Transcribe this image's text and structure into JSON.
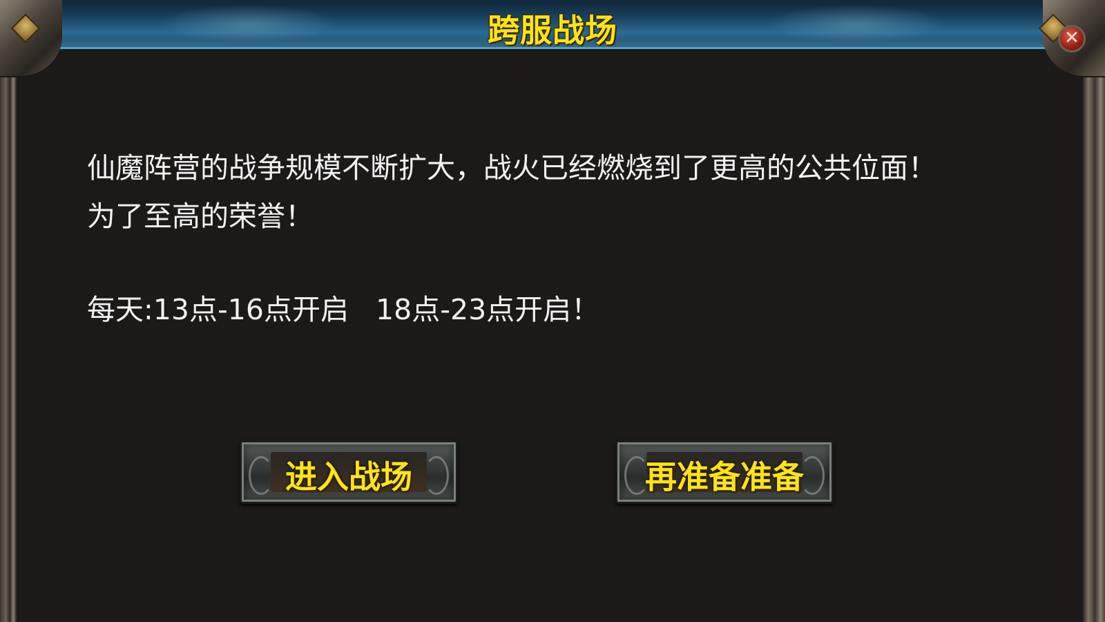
{
  "dialog": {
    "title": "跨服战场",
    "close_icon": "close-icon",
    "close_glyph": "✕"
  },
  "content": {
    "line1": "仙魔阵营的战争规模不断扩大，战火已经燃烧到了更高的公共位面！",
    "line2": "为了至高的荣誉！",
    "schedule": "每天:13点-16点开启   18点-23点开启！"
  },
  "buttons": {
    "enter_label": "进入战场",
    "wait_label": "再准备准备"
  },
  "colors": {
    "title": "#ffe417",
    "button_text": "#ffe417",
    "body_text": "#f2f2f2",
    "panel_bg": "#1c1a19",
    "title_bar_accent": "#4fa3c9"
  }
}
